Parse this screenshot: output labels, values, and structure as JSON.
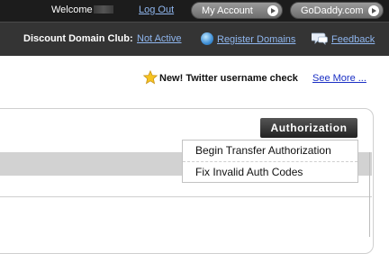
{
  "topbar": {
    "welcome": "Welcome",
    "logout": "Log Out",
    "my_account": "My Account",
    "godaddy": "GoDaddy.com"
  },
  "nav": {
    "discount_label": "Discount Domain Club:",
    "discount_status": "Not Active",
    "register_domains": "Register Domains",
    "feedback": "Feedback"
  },
  "announcement": {
    "text": "New! Twitter username check",
    "link": "See More ..."
  },
  "panel": {
    "authorization_label": "Authorization",
    "menu": [
      {
        "label": "Begin Transfer Authorization"
      },
      {
        "label": "Fix Invalid Auth Codes"
      }
    ]
  },
  "colors": {
    "topbar": "#1c1c1c",
    "navbar": "#343434",
    "link_on_dark": "#8fb6ee",
    "link_on_light": "#1a2fc4"
  },
  "icons": [
    "globe-icon",
    "feedback-icon",
    "star-icon",
    "play-arrow-icon"
  ]
}
